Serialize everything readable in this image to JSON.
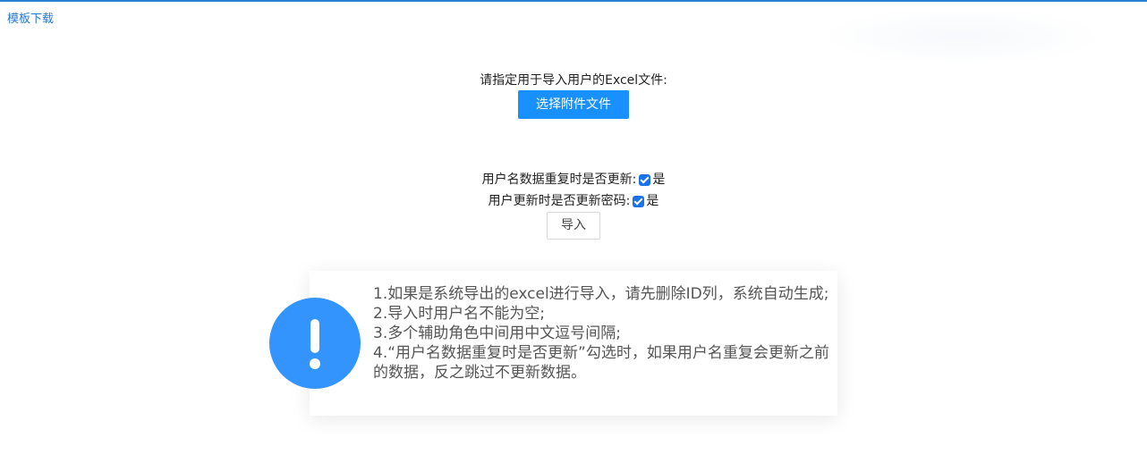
{
  "header": {
    "template_download": "模板下载"
  },
  "upload": {
    "label": "请指定用于导入用户的Excel文件:",
    "button": "选择附件文件"
  },
  "options": [
    {
      "label": "用户名数据重复时是否更新:",
      "checked": true,
      "value_text": "是"
    },
    {
      "label": "用户更新时是否更新密码:",
      "checked": true,
      "value_text": "是"
    }
  ],
  "import_button": "导入",
  "notice": {
    "icon": "exclamation-icon",
    "lines": [
      "1.如果是系统导出的excel进行导入，请先删除ID列，系统自动生成;",
      "2.导入时用户名不能为空;",
      "3.多个辅助角色中间用中文逗号间隔;",
      "4.“用户名数据重复时是否更新”勾选时，如果用户名重复会更新之前的数据，反之跳过不更新数据。"
    ]
  },
  "colors": {
    "primary": "#1890ff",
    "link": "#1f7ad6",
    "notice_icon": "#3394fd"
  }
}
